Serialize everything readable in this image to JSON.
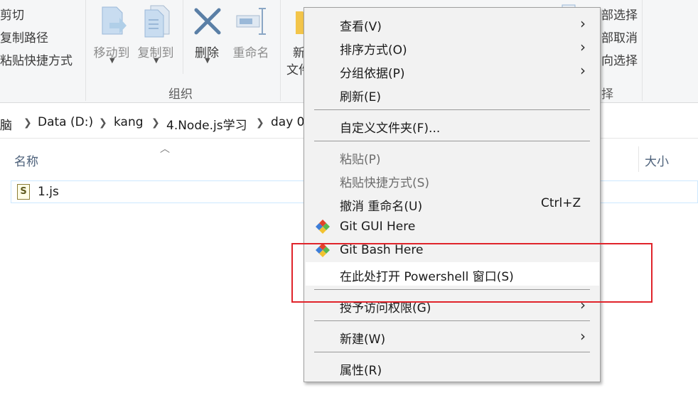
{
  "ribbon": {
    "clipboard_items": [
      "剪切",
      "复制路径",
      "粘贴快捷方式"
    ],
    "buttons": {
      "move_to": "移动到",
      "copy_to": "复制到",
      "delete": "删除",
      "rename": "重命名",
      "new_folder_line1": "新",
      "new_folder_line2": "文件"
    },
    "group_label": "组织",
    "select_items": [
      "部选择",
      "部取消",
      "向选择"
    ],
    "select_group_label": "择"
  },
  "address": {
    "crumbs": [
      "脑",
      "Data (D:)",
      "kang",
      "4.Node.js学习",
      "day 0"
    ]
  },
  "list": {
    "header_name": "名称",
    "header_size": "大小",
    "file_name": "1.js"
  },
  "context_menu": {
    "items": [
      {
        "label": "查看(V)",
        "submenu": true
      },
      {
        "label": "排序方式(O)",
        "submenu": true
      },
      {
        "label": "分组依据(P)",
        "submenu": true
      },
      {
        "label": "刷新(E)"
      },
      {
        "label": "自定义文件夹(F)..."
      },
      {
        "label": "粘贴(P)",
        "disabled": true
      },
      {
        "label": "粘贴快捷方式(S)",
        "disabled": true
      },
      {
        "label": "撤消 重命名(U)",
        "shortcut": "Ctrl+Z"
      },
      {
        "label": "Git GUI Here"
      },
      {
        "label": "Git Bash Here"
      },
      {
        "label": "在此处打开 Powershell 窗口(S)",
        "highlighted": true
      },
      {
        "label": "授予访问权限(G)",
        "submenu": true
      },
      {
        "label": "新建(W)",
        "submenu": true
      },
      {
        "label": "属性(R)"
      }
    ]
  },
  "colors": {
    "annotation_red": "#e0242b",
    "git_red": "#e24329",
    "git_green": "#5bb84f",
    "git_blue": "#3d7dd8",
    "git_yellow": "#f2c230"
  }
}
